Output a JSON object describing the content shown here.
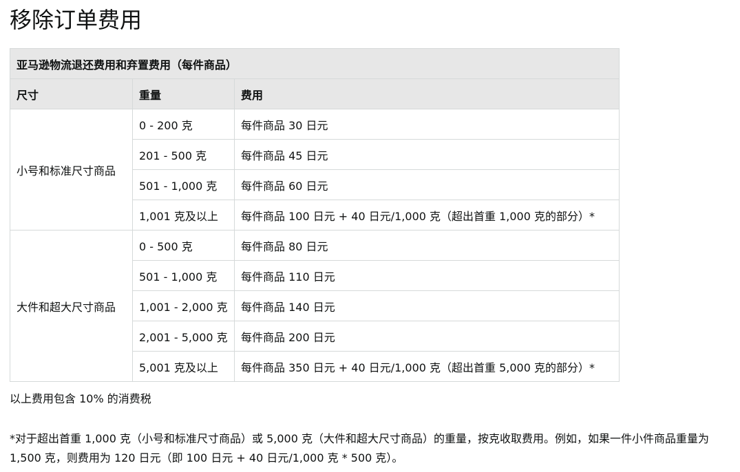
{
  "title": "移除订单费用",
  "table": {
    "caption": "亚马逊物流退还费用和弃置费用（每件商品）",
    "headers": [
      "尺寸",
      "重量",
      "费用"
    ],
    "groups": [
      {
        "size": "小号和标准尺寸商品",
        "rows": [
          {
            "weight": "0 - 200 克",
            "fee": "每件商品 30 日元"
          },
          {
            "weight": "201 - 500 克",
            "fee": "每件商品 45 日元"
          },
          {
            "weight": "501 - 1,000 克",
            "fee": "每件商品 60 日元"
          },
          {
            "weight": "1,001 克及以上",
            "fee": "每件商品 100 日元 + 40 日元/1,000 克（超出首重 1,000 克的部分）*"
          }
        ]
      },
      {
        "size": "大件和超大尺寸商品",
        "rows": [
          {
            "weight": "0 - 500 克",
            "fee": "每件商品 80 日元"
          },
          {
            "weight": "501 - 1,000 克",
            "fee": "每件商品 110 日元"
          },
          {
            "weight": "1,001 - 2,000 克",
            "fee": "每件商品 140 日元"
          },
          {
            "weight": "2,001 - 5,000 克",
            "fee": "每件商品 200 日元"
          },
          {
            "weight": "5,001 克及以上",
            "fee": "每件商品 350 日元 + 40 日元/1,000 克（超出首重 5,000 克的部分）*"
          }
        ]
      }
    ]
  },
  "tax_note": "以上费用包含 10% 的消费税",
  "footnote": "*对于超出首重 1,000 克（小号和标准尺寸商品）或 5,000 克（大件和超大尺寸商品）的重量，按克收取费用。例如，如果一件小件商品重量为 1,500 克，则费用为 120 日元（即 100 日元 + 40 日元/1,000 克 * 500 克）。"
}
